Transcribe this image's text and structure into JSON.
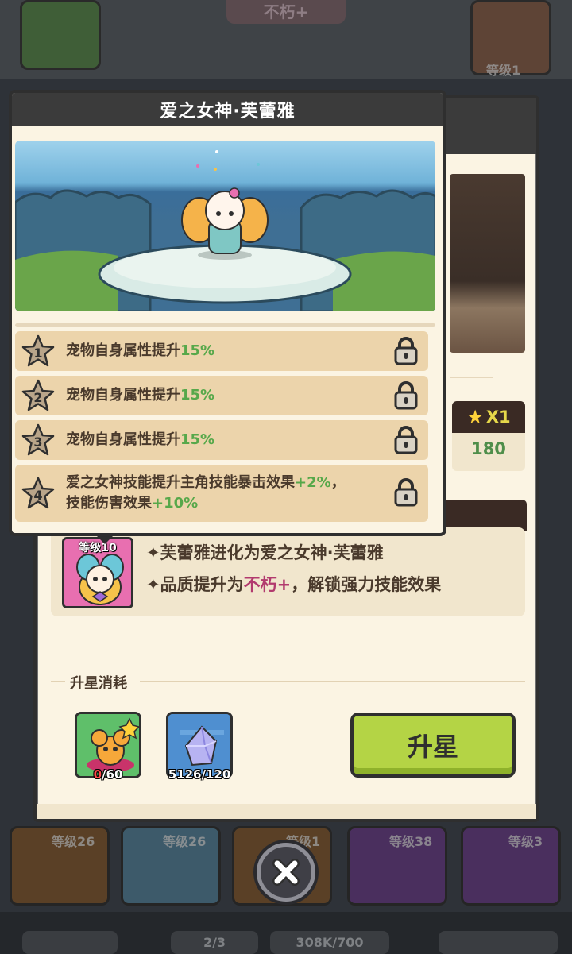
{
  "background": {
    "rarity_tag": "不朽+",
    "level_tags": [
      "等级1"
    ],
    "grid_levels": [
      "等级26",
      "等级26",
      "等级1",
      "等级38",
      "等级3"
    ],
    "bottom_bar": {
      "count_label": "2/3",
      "resource_label": "308K/700"
    }
  },
  "popup": {
    "title": "爱之女神·芙蕾雅",
    "skills": [
      {
        "num": "1",
        "prefix": "宠物自身属性提升",
        "value": "15%"
      },
      {
        "num": "2",
        "prefix": "宠物自身属性提升",
        "value": "15%"
      },
      {
        "num": "3",
        "prefix": "宠物自身属性提升",
        "value": "15%"
      },
      {
        "num": "4",
        "line1_prefix": "爱之女神技能提升主角技能暴击效果",
        "line1_value": "+2%",
        "line1_suffix": "，",
        "line2_prefix": "技能伤害效果",
        "line2_value": "+10%"
      }
    ]
  },
  "panel": {
    "star_cost": {
      "multiplier": "X1",
      "value": "180"
    },
    "evolution": {
      "pet_level": "等级10",
      "line1": "✦芙蕾雅进化为爱之女神·芙蕾雅",
      "line2_prefix": "✦品质提升为",
      "line2_quality": "不朽+",
      "line2_suffix": "，解锁强力技能效果"
    },
    "cost_title": "升星消耗",
    "materials": [
      {
        "name": "pet-shard",
        "have": "0",
        "need": "/60"
      },
      {
        "name": "crystal",
        "count": "5126/120"
      }
    ],
    "star_up_label": "升星"
  },
  "colors": {
    "green_value": "#57a84a",
    "quality_pink": "#b23a6e",
    "button_green": "#b4d445"
  }
}
